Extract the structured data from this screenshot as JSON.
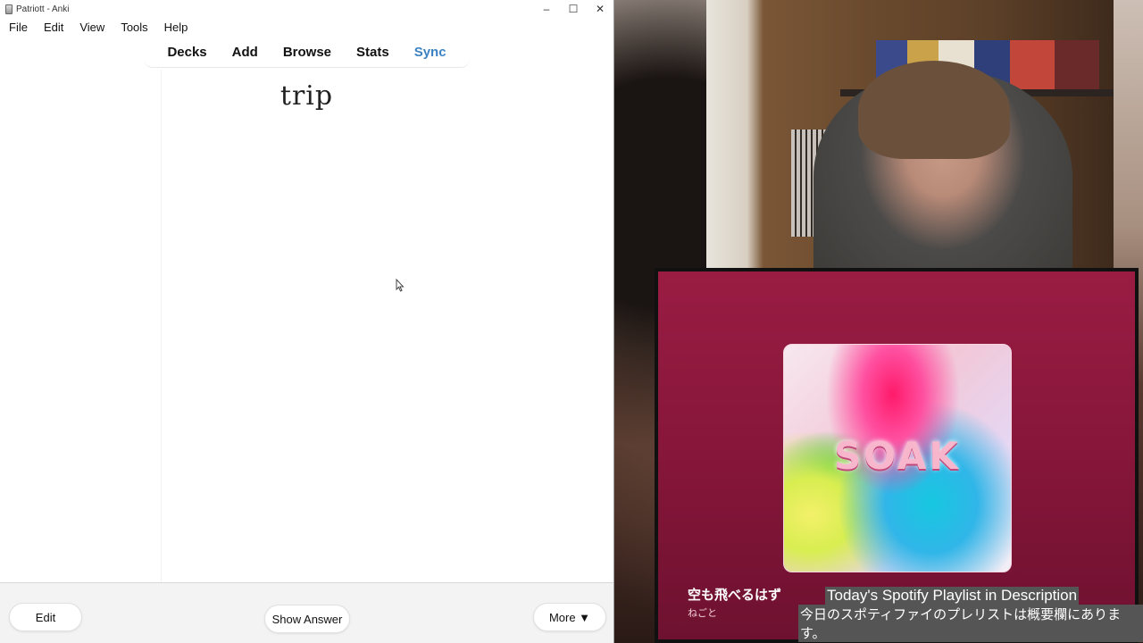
{
  "window": {
    "title": "Patriott - Anki",
    "controls": {
      "minimize": "–",
      "maximize": "☐",
      "close": "✕"
    }
  },
  "menubar": {
    "items": [
      "File",
      "Edit",
      "View",
      "Tools",
      "Help"
    ]
  },
  "topnav": {
    "items": [
      "Decks",
      "Add",
      "Browse",
      "Stats",
      "Sync"
    ]
  },
  "card": {
    "front": "trip"
  },
  "bottom": {
    "edit": "Edit",
    "show_answer": "Show Answer",
    "more": "More ▼"
  },
  "now_playing": {
    "title": "空も飛べるはず",
    "artist": "ねごと",
    "album_text": "SOAK"
  },
  "subtitles": {
    "en": "Today's Spotify Playlist in Description",
    "ja": "今日のスポティファイのプレリストは概要欄にあります。"
  },
  "colors": {
    "sync_link": "#3b82c4",
    "overlay_panel": "#8a173d"
  }
}
